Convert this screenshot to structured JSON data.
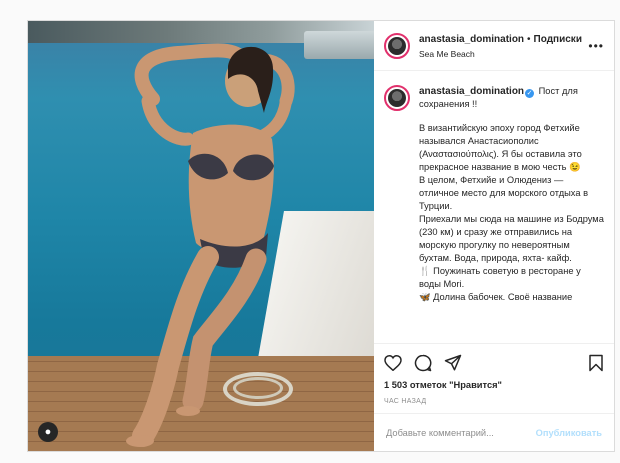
{
  "post": {
    "username": "anastasia_domination",
    "follow_label": "Подписки",
    "separator": "•",
    "location": "Sea Me Beach",
    "more_label": "•••",
    "verified_mark": "✓",
    "caption_lead": "Пост для сохранения !!",
    "caption_text": "В византийскую эпоху город Фетхийе назывался Анастасиополис (Αναστασιούπολις). Я бы оставила это прекрасное название в мою честь 😉\nВ целом, Фетхийе и Олюдениз — отличное место для морского отдыха в Турции.\nПриехали мы сюда на машине из Бодрума (230 км) и сразу же отправились на морскую прогулку по невероятным бухтам. Вода, природа, яхта- кайф.\n🍴 Поужинать советую в ресторане у воды Mori.\n🦋 Долина бабочек. Своё название",
    "likes": "1 503 отметок \"Нравится\"",
    "time": "ЧАС НАЗАД",
    "comment_placeholder": "Добавьте комментарий...",
    "publish_label": "Опубликовать"
  },
  "icons": {
    "like": "heart-icon",
    "comment": "comment-icon",
    "share": "share-icon",
    "save": "bookmark-icon",
    "tag": "user-tag-icon",
    "more": "more-icon"
  },
  "colors": {
    "follow_ring": "#e1306c",
    "verified": "#3897f0",
    "publish_disabled": "#b2dffc"
  }
}
